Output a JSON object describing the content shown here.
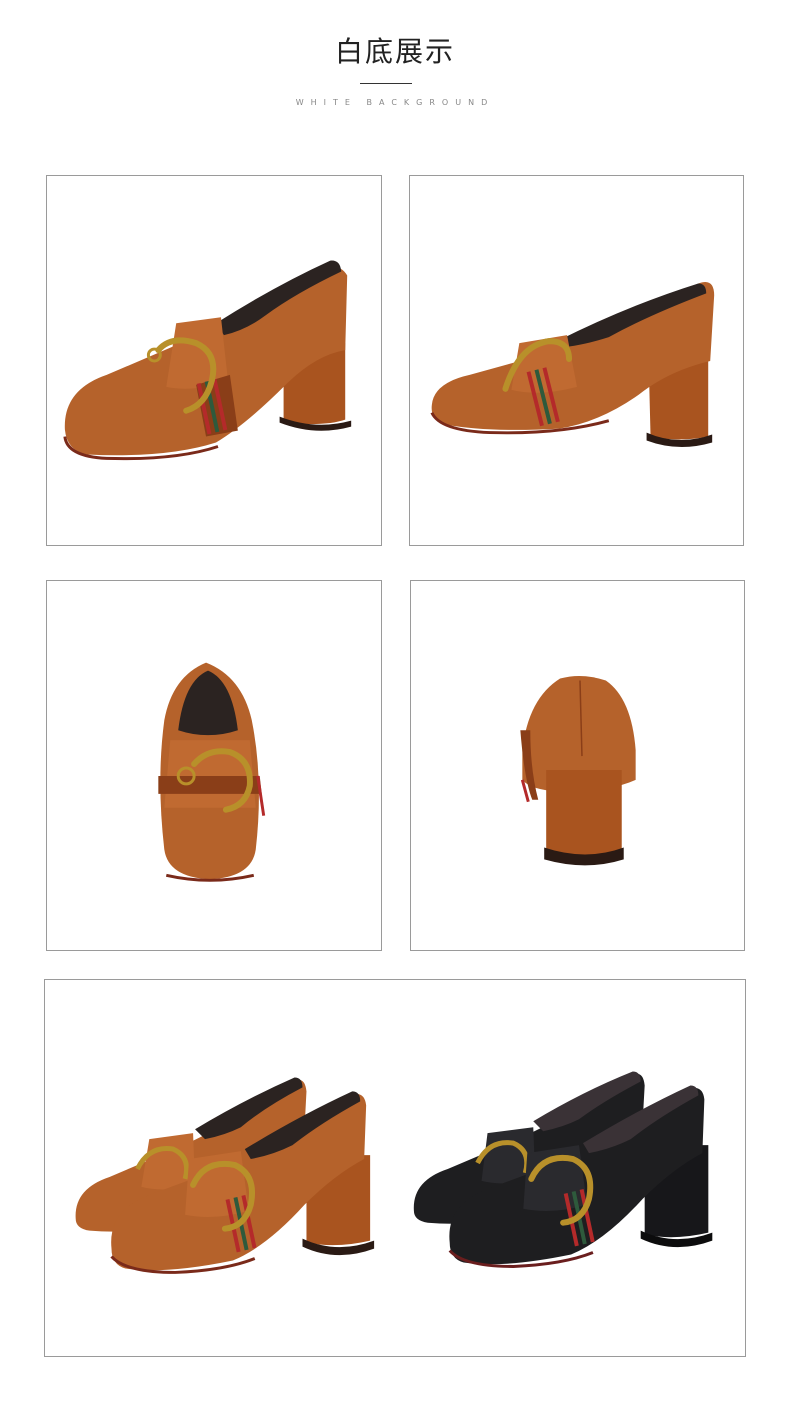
{
  "header": {
    "title": "白底展示",
    "subtitle": "WHITE BACKGROUND"
  },
  "gallery": {
    "items": [
      {
        "icon": "brown-loafer-pump-side-left-icon",
        "color": "#b5622b"
      },
      {
        "icon": "brown-loafer-pump-side-right-icon",
        "color": "#b5622b"
      },
      {
        "icon": "brown-loafer-pump-front-icon",
        "color": "#b5622b"
      },
      {
        "icon": "brown-loafer-pump-back-icon",
        "color": "#b5622b"
      },
      {
        "icon": "loafer-pump-pairs-brown-black-icon",
        "colors": [
          "#b5622b",
          "#1e1e20"
        ]
      }
    ]
  },
  "colors": {
    "leather_brown": "#b5622b",
    "leather_black": "#1e1e20",
    "buckle_gold": "#b8902a",
    "stripe_red": "#b42a2a",
    "stripe_green": "#2e5a3c",
    "frame_border": "#9a9a9a"
  }
}
